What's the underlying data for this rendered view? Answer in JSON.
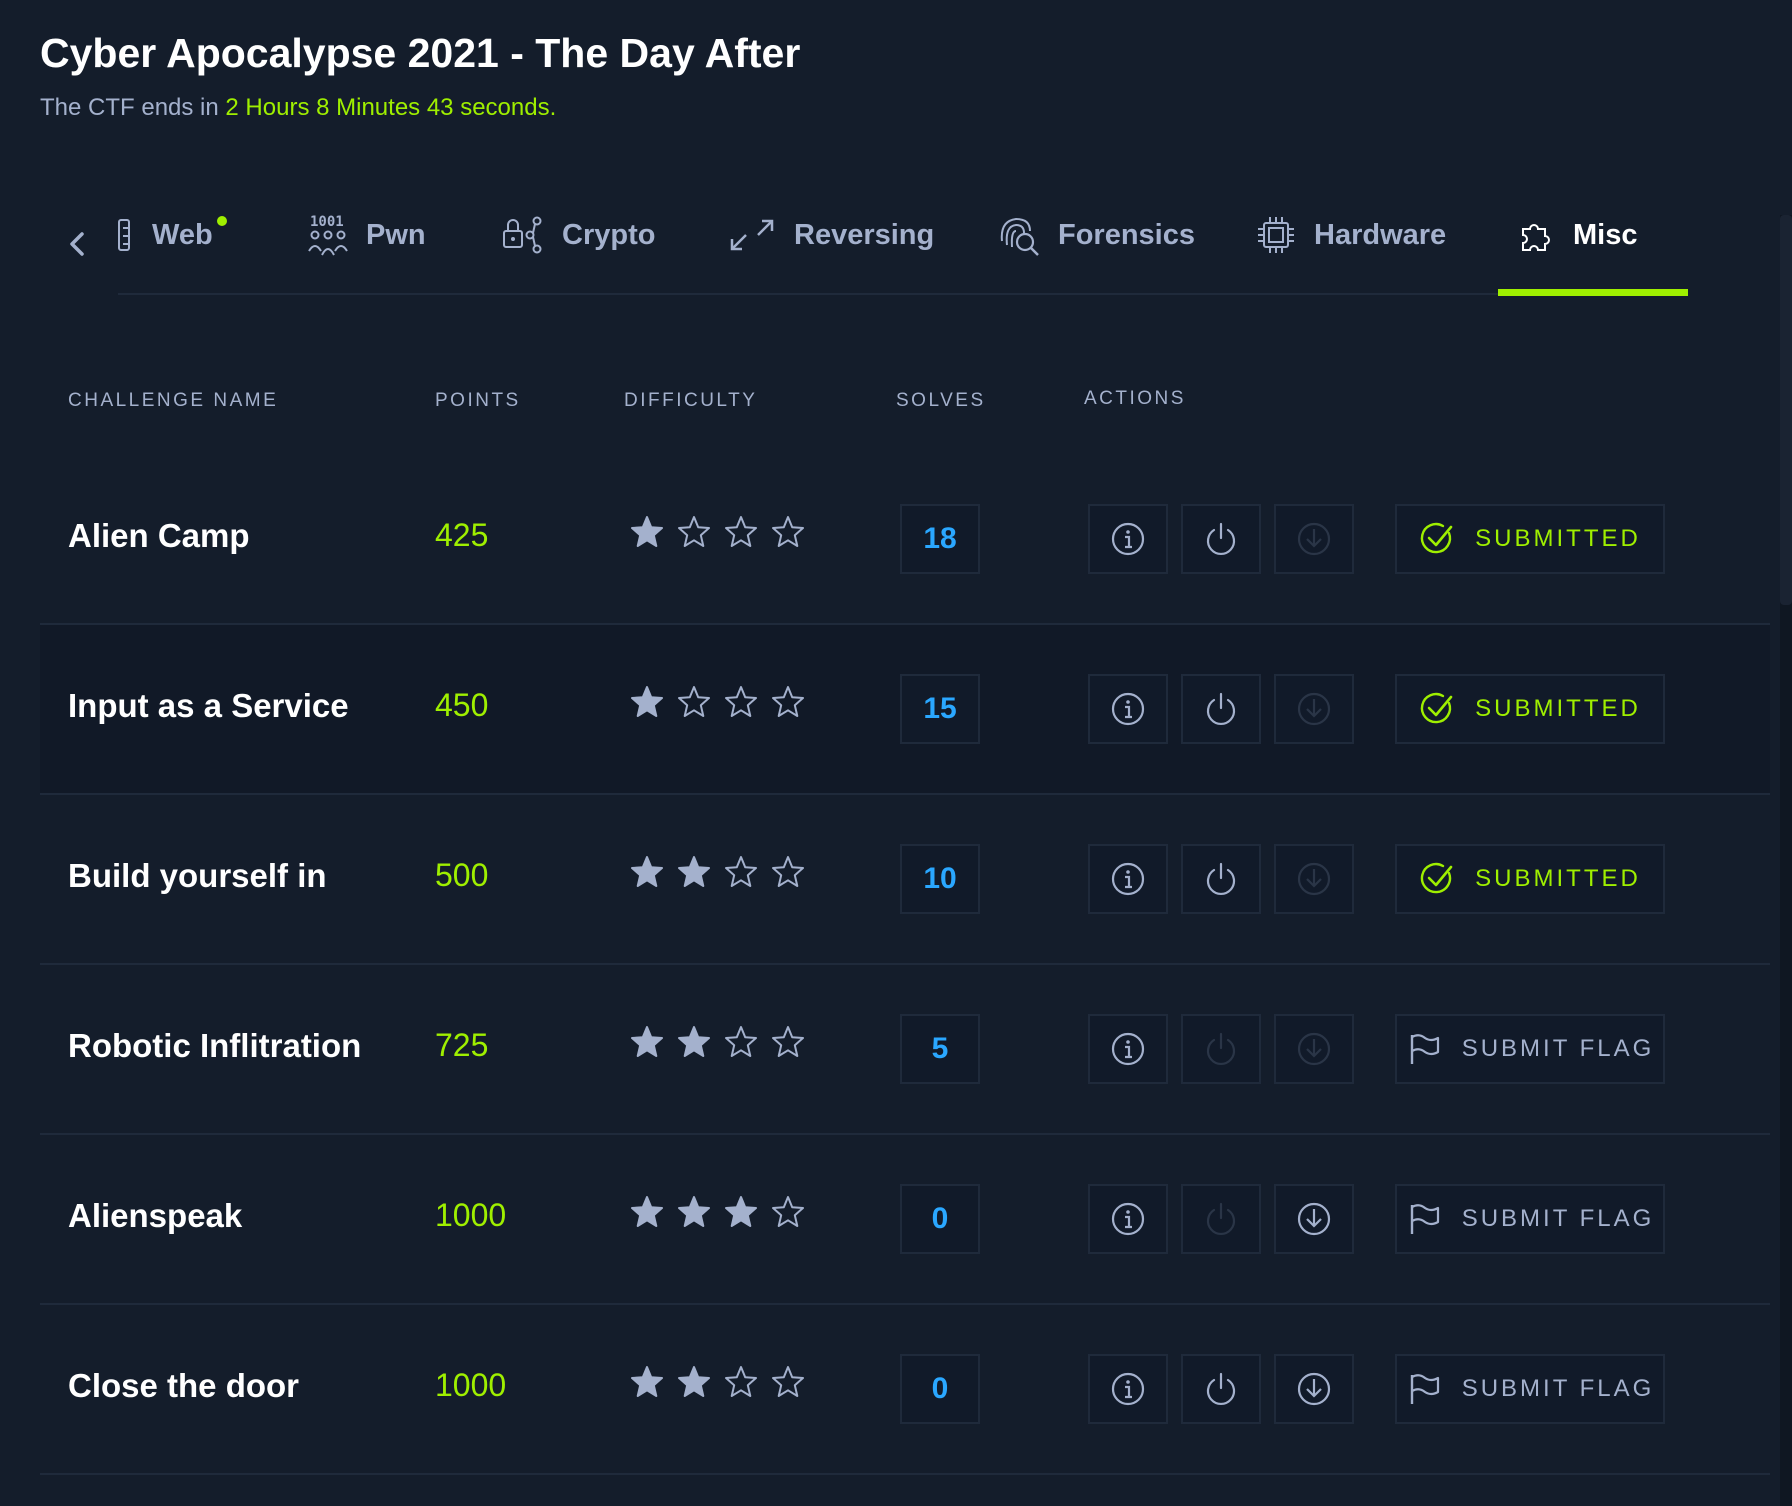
{
  "header": {
    "title": "Cyber Apocalypse 2021 - The Day After",
    "subtitle_prefix": "The CTF ends in ",
    "timer": "2 Hours 8 Minutes 43 seconds."
  },
  "tabs": [
    {
      "label": "Web",
      "icon": "web-icon",
      "has_dot": true
    },
    {
      "label": "Pwn",
      "icon": "binary-icon"
    },
    {
      "label": "Crypto",
      "icon": "lock-share-icon"
    },
    {
      "label": "Reversing",
      "icon": "expand-arrows-icon"
    },
    {
      "label": "Forensics",
      "icon": "fingerprint-search-icon"
    },
    {
      "label": "Hardware",
      "icon": "chip-icon"
    },
    {
      "label": "Misc",
      "icon": "puzzle-icon",
      "active": true
    }
  ],
  "table": {
    "columns": [
      "CHALLENGE NAME",
      "POINTS",
      "DIFFICULTY",
      "SOLVES",
      "ACTIONS"
    ],
    "rows": [
      {
        "name": "Alien Camp",
        "points": "425",
        "difficulty": 1,
        "solves": "18",
        "status": "SUBMITTED",
        "submitted": true,
        "power_enabled": true,
        "download_enabled": false
      },
      {
        "name": "Input as a Service",
        "points": "450",
        "difficulty": 1,
        "solves": "15",
        "status": "SUBMITTED",
        "submitted": true,
        "power_enabled": true,
        "download_enabled": false
      },
      {
        "name": "Build yourself in",
        "points": "500",
        "difficulty": 2,
        "solves": "10",
        "status": "SUBMITTED",
        "submitted": true,
        "power_enabled": true,
        "download_enabled": false
      },
      {
        "name": "Robotic Inflitration",
        "points": "725",
        "difficulty": 2,
        "solves": "5",
        "status": "SUBMIT FLAG",
        "submitted": false,
        "power_enabled": false,
        "download_enabled": false
      },
      {
        "name": "Alienspeak",
        "points": "1000",
        "difficulty": 3,
        "solves": "0",
        "status": "SUBMIT FLAG",
        "submitted": false,
        "power_enabled": false,
        "download_enabled": true
      },
      {
        "name": "Close the door",
        "points": "1000",
        "difficulty": 2,
        "solves": "0",
        "status": "SUBMIT FLAG",
        "submitted": false,
        "power_enabled": true,
        "download_enabled": true
      }
    ]
  },
  "colors": {
    "background": "#141d2b",
    "accent_green": "#9fef00",
    "solves_blue": "#2aa7ff",
    "muted_text": "#a4b1cd"
  }
}
